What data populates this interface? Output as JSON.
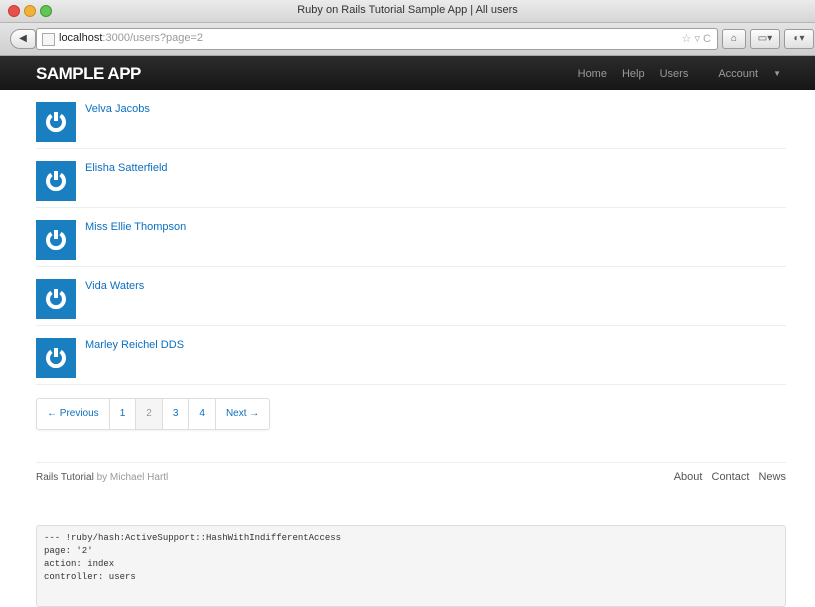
{
  "window": {
    "title": "Ruby on Rails Tutorial Sample App | All users"
  },
  "browser": {
    "url_host": "localhost",
    "url_rest": ":3000/users?page=2",
    "star_glyph": "☆ ▿ C",
    "home_glyph": "⌂",
    "menu_glyph": "▭▾",
    "extra_glyph": "◐▾"
  },
  "navbar": {
    "brand": "SAMPLE APP",
    "links": [
      "Home",
      "Help",
      "Users",
      "Account"
    ]
  },
  "users": [
    {
      "name": "Velva Jacobs"
    },
    {
      "name": "Elisha Satterfield"
    },
    {
      "name": "Miss Ellie Thompson"
    },
    {
      "name": "Vida Waters"
    },
    {
      "name": "Marley Reichel DDS"
    }
  ],
  "pagination": {
    "previous": "← Previous",
    "pages": [
      "1",
      "2",
      "3",
      "4"
    ],
    "current": "2",
    "next": "Next →"
  },
  "footer": {
    "brand": "Rails Tutorial",
    "by": "by Michael Hartl",
    "links": [
      "About",
      "Contact",
      "News"
    ]
  },
  "debug": {
    "lines": [
      "--- !ruby/hash:ActiveSupport::HashWithIndifferentAccess",
      "page: '2'",
      "action: index",
      "controller: users"
    ]
  },
  "colors": {
    "link": "#0c6fc0",
    "avatar": "#1a7fc1",
    "navbar": "#1f1f1f"
  }
}
